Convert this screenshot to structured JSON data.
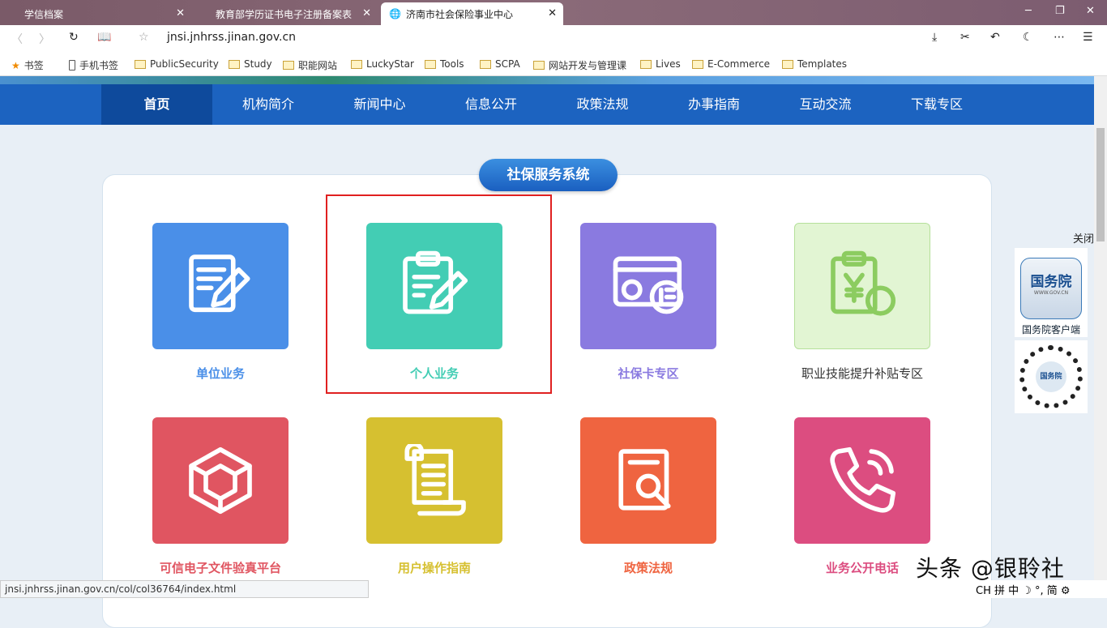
{
  "tabs": [
    {
      "label": "学信档案"
    },
    {
      "label": "教育部学历证书电子注册备案表"
    },
    {
      "label": "济南市社会保险事业中心",
      "active": true
    }
  ],
  "address": {
    "url": "jnsi.jnhrss.jinan.gov.cn"
  },
  "bookmarks": [
    "书签",
    "手机书签",
    "PublicSecurity",
    "Study",
    "职能网站",
    "LuckyStar",
    "Tools",
    "SCPA",
    "网站开发与管理课",
    "Lives",
    "E-Commerce",
    "Templates"
  ],
  "nav": [
    "首页",
    "机构简介",
    "新闻中心",
    "信息公开",
    "政策法规",
    "办事指南",
    "互动交流",
    "下载专区"
  ],
  "section_title": "社保服务系统",
  "tiles": [
    {
      "label": "单位业务",
      "icon": "document-edit-icon",
      "color": "#4a8fe8"
    },
    {
      "label": "个人业务",
      "icon": "clipboard-edit-icon",
      "color": "#43cdb4"
    },
    {
      "label": "社保卡专区",
      "icon": "si-card-icon",
      "color": "#8a7ae0"
    },
    {
      "label": "职业技能提升补贴专区",
      "icon": "clipboard-yen-icon",
      "color": "#e2f5d3"
    },
    {
      "label": "可信电子文件验真平台",
      "icon": "cube-icon",
      "color": "#e05561"
    },
    {
      "label": "用户操作指南",
      "icon": "scroll-icon",
      "color": "#d6c030"
    },
    {
      "label": "政策法规",
      "icon": "document-search-icon",
      "color": "#ef6440"
    },
    {
      "label": "业务公开电话",
      "icon": "phone-icon",
      "color": "#dc4d80"
    }
  ],
  "side": {
    "close": "关闭",
    "app_name": "国务院",
    "app_url": "WWW.GOV.CN",
    "app_caption": "国务院客户端"
  },
  "status_url": "jnsi.jnhrss.jinan.gov.cn/col/col36764/index.html",
  "watermark": "头条 @银聆社",
  "ime": "CH 拼 中 ☽ °, 简 ⚙"
}
